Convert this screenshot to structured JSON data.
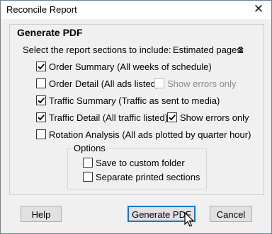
{
  "window": {
    "title": "Reconcile Report",
    "close_glyph": "✕"
  },
  "group": {
    "title": "Generate PDF",
    "instructions": "Select the report sections to include:",
    "estimated_label": "Estimated pages:",
    "estimated_value": "3"
  },
  "sections": [
    {
      "label": "Order Summary (All weeks of schedule)",
      "checked": true
    },
    {
      "label": "Order Detail (All ads listed)",
      "checked": false
    },
    {
      "label": "Traffic Summary (Traffic as sent to media)",
      "checked": true
    },
    {
      "label": "Traffic Detail (All traffic listed)",
      "checked": true
    },
    {
      "label": "Rotation Analysis (All ads plotted by quarter hour)",
      "checked": false
    }
  ],
  "show_errors": [
    {
      "label": "Show errors only",
      "checked": false,
      "enabled": false
    },
    {
      "label": "Show errors only",
      "checked": true,
      "enabled": true
    }
  ],
  "options": {
    "title": "Options",
    "items": [
      {
        "label": "Save to custom folder",
        "checked": false
      },
      {
        "label": "Separate printed sections",
        "checked": false
      }
    ]
  },
  "buttons": {
    "help": "Help",
    "generate": "Generate PDF",
    "cancel": "Cancel"
  },
  "colors": {
    "accent": "#0078d7",
    "disabled_text": "#8c8c8c"
  }
}
